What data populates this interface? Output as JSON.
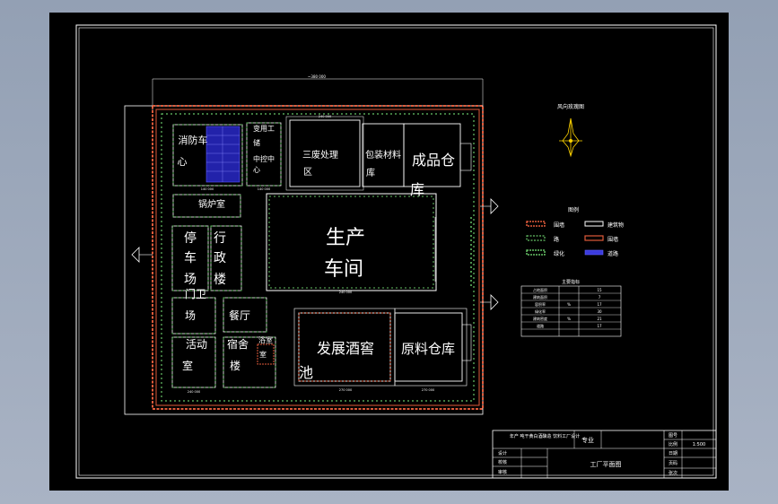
{
  "drawing": {
    "dimensions": {
      "top": "~380 000",
      "b1": "240 000",
      "b2": "240 000",
      "b3": "140 000",
      "b4": "140 000",
      "prod": "240 000",
      "b5": "270 000",
      "b6": "270 000",
      "b7": "270 000"
    },
    "buildings": {
      "pump_line1": "消防车",
      "pump_line2": "心",
      "power_line1": "变用工",
      "power_line2": "储",
      "power_line3": "中控中",
      "power_line4": "心",
      "waste_line1": "三废处理",
      "waste_line2": "区",
      "pack_line1": "包装材料",
      "pack_line2": "库",
      "product_store_line1": "成品仓",
      "product_store_line2": "库",
      "boiler": "锅炉室",
      "production_line1": "生产",
      "production_line2": "车间",
      "parking_1": "停",
      "parking_2": "车",
      "parking_3": "场",
      "admin_1": "行",
      "admin_2": "政",
      "admin_3": "楼",
      "guard_1": "门卫",
      "guard_2": "场",
      "canteen": "餐厅",
      "activity_1": "活动",
      "activity_2": "室",
      "dorm_1": "宿舍",
      "dorm_2": "楼",
      "dorm_3": "浴室",
      "dorm_4": "室",
      "ferment_1": "发展酒窖",
      "ferment_2": "池",
      "raw_store": "原料仓库"
    },
    "wind_title": "风向玫瑰图",
    "legend": {
      "title": "图例",
      "items": [
        {
          "label": "围墙",
          "color": "#e05a3a"
        },
        {
          "label": "路",
          "color": "#66c266"
        },
        {
          "label": "绿化",
          "color": "#66c266"
        },
        {
          "label": "建筑物",
          "color": "#ffffff"
        },
        {
          "label": "围墙",
          "color": "#e05a3a"
        },
        {
          "label": "道路",
          "color": "#3b3bdd"
        }
      ]
    },
    "stats_table": {
      "title": "主要指标",
      "rows": [
        [
          "占地面积",
          "",
          "15"
        ],
        [
          "建筑面积",
          "",
          "7"
        ],
        [
          "容积率",
          "%",
          "17"
        ],
        [
          "绿化率",
          "",
          "30"
        ],
        [
          "建筑密度",
          "%",
          "21"
        ],
        [
          "道路",
          "",
          "17"
        ],
        [
          "",
          "",
          ""
        ]
      ]
    },
    "title_block": {
      "project": "年产 吨干黄白酒酿造 饮料工厂设计",
      "specialty": "专业",
      "designer_label": "设计",
      "checker_label": "校核",
      "approver_label": "审核",
      "drawing_title": "工厂平面图",
      "right_labels": [
        "图号",
        "比例",
        "日期",
        "页码",
        "张次"
      ],
      "scale": "1:500"
    }
  }
}
